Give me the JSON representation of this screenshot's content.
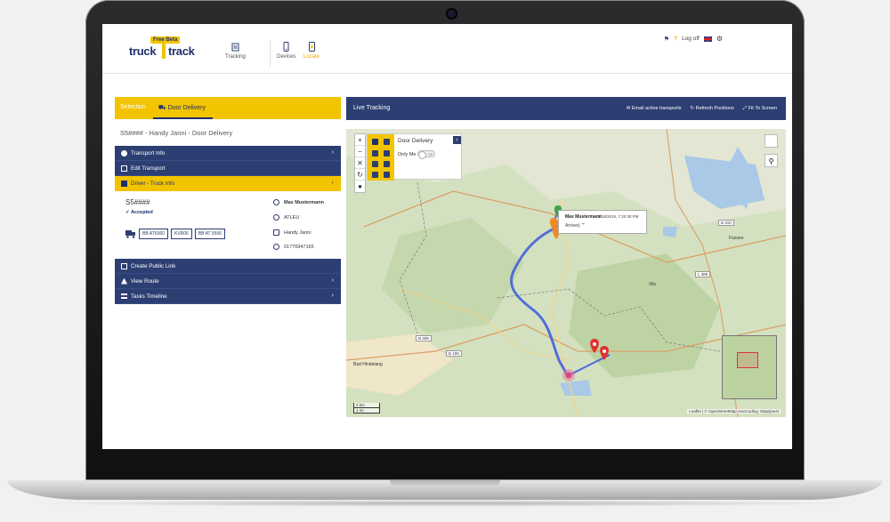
{
  "app": {
    "logo_badge": "Free Beta",
    "logo_word1": "truck",
    "logo_word2": "track"
  },
  "nav": {
    "tracking": "Tracking",
    "devices": "Devices",
    "locate": "Locate",
    "logoff": "Log off",
    "help": "?"
  },
  "left": {
    "tab_selection": "Selection",
    "tab_door": "Door Delivery",
    "transport_title": "S5#### - Handy Janni - Door Delivery",
    "menu_top": [
      {
        "label": "Transport Info"
      },
      {
        "label": "Edit Transport"
      },
      {
        "label": "Driver - Truck Info"
      }
    ],
    "detail": {
      "id": "S5####",
      "status": "Accepted",
      "driver": "Max Mustermann",
      "company": "ATLEU",
      "device": "Handy Janni",
      "phone": "01776947165",
      "plate1": "BB AT5060",
      "plate2": "KVR06",
      "plate3": "BB AT 5566"
    },
    "menu_bottom": [
      {
        "label": "Create Public Link"
      },
      {
        "label": "View Route"
      },
      {
        "label": "Tasks Timeline"
      }
    ]
  },
  "live": {
    "title": "Live Tracking",
    "email": "Email active transports",
    "refresh": "Refresh Positions",
    "fit": "Fit To Screen"
  },
  "map": {
    "panel_title": "Door Delivery",
    "only_me": "Only Me",
    "toggle_off": "Off",
    "popup_name": "Max Mustermann",
    "popup_time": "2/18/2015, 7:20:30 PM",
    "popup_status": "Arrived, \"\"",
    "place_labels": [
      "Vils",
      "Füssen",
      "Bad Hindelang"
    ],
    "road_labels": [
      "B 310",
      "B 308",
      "B 199",
      "L 389"
    ],
    "scale_km": "2 km",
    "scale_mi": "1 mi",
    "attribution": "Leaflet | © OpenStreetMap GeoCoding: MapQuest"
  }
}
